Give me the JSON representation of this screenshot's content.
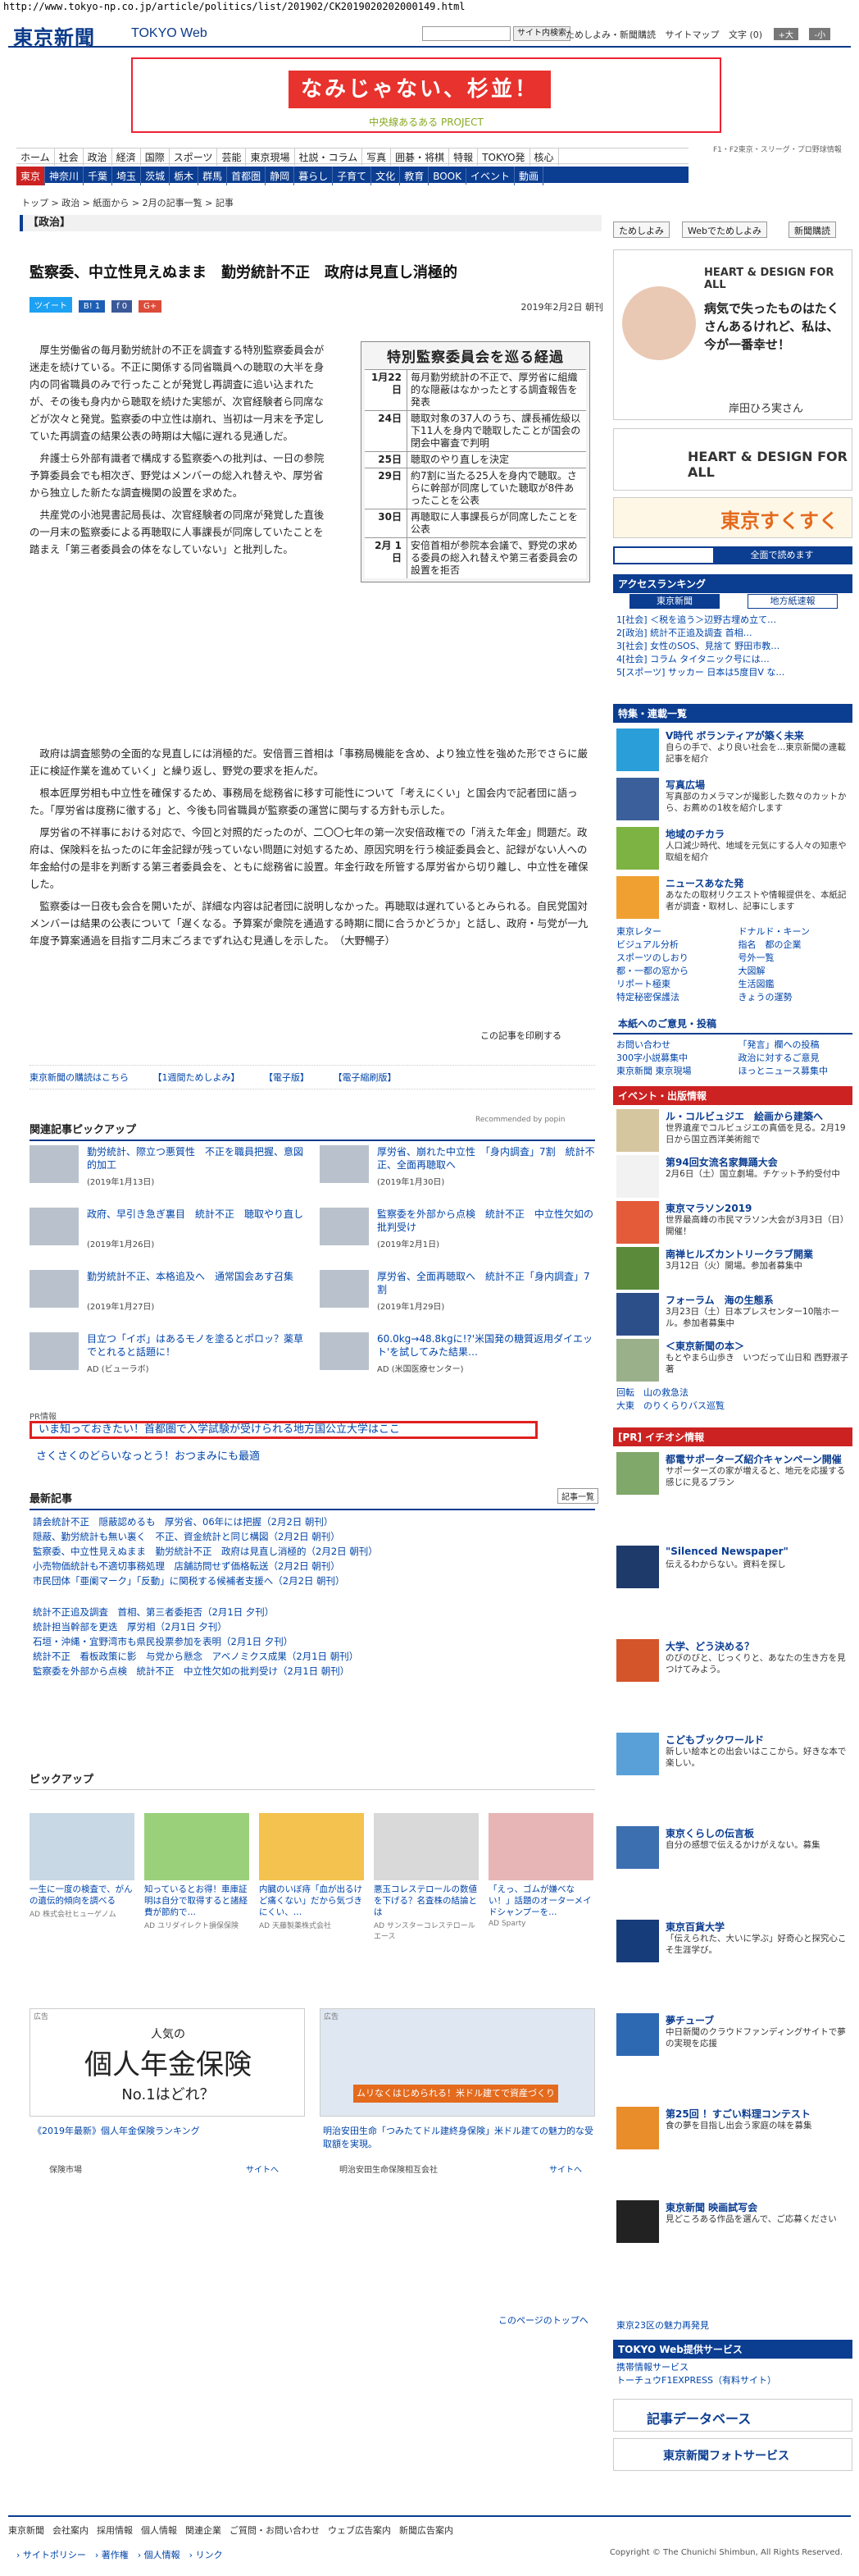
{
  "url": "http://www.tokyo-np.co.jp/article/politics/list/201902/CK2019020202000149.html",
  "header": {
    "logo": "東京新聞",
    "logo_sub": "TOKYO Web",
    "search_button": "サイト内検索",
    "links": [
      "ためしよみ・新聞購読",
      "サイトマップ",
      "文字 (0)"
    ],
    "size_plus": "+大",
    "size_minus": "-小"
  },
  "banner": {
    "main": "なみじゃない、杉並！",
    "sub": "中央線あるある PROJECT"
  },
  "nav_top": [
    "ホーム",
    "社会",
    "政治",
    "経済",
    "国際",
    "スポーツ",
    "芸能",
    "東京現場",
    "社説・コラム",
    "写真",
    "囲碁・将棋",
    "特報",
    "TOKYO発",
    "核心"
  ],
  "nav_bottom": [
    "東京",
    "神奈川",
    "千葉",
    "埼玉",
    "茨城",
    "栃木",
    "群馬",
    "首都圏",
    "静岡",
    "暮らし",
    "子育て",
    "文化",
    "教育",
    "BOOK",
    "イベント",
    "動画"
  ],
  "sponsor_small": "F1・F2東京・スリーグ・プロ野球情報",
  "breadcrumb": "トップ > 政治 > 紙面から > 2月の記事一覧 > 記事",
  "section": "【政治】",
  "article": {
    "headline": "監察委、中立性見えぬまま　勤労統計不正　政府は見直し消極的",
    "share": [
      "ツイート",
      "B! 1",
      "f 0",
      "G+"
    ],
    "date": "2019年2月2日 朝刊",
    "lead": [
      "厚生労働省の毎月勤労統計の不正を調査する特別監察委員会が迷走を続けている。不正に関係する同省職員への聴取の大半を身内の同省職員のみで行ったことが発覚し再調査に追い込まれたが、その後も身内から聴取を続けた実態が、次官経験者ら同席などが次々と発覚。監察委の中立性は崩れ、当初は一月末を予定していた再調査の結果公表の時期は大幅に遅れる見通しだ。",
      "弁護士ら外部有識者で構成する監察委への批判は、一日の参院予算委員会でも相次ぎ、野党はメンバーの総入れ替えや、厚労省から独立した新たな調査機関の設置を求めた。",
      "共産党の小池晃書記局長は、次官経験者の同席が発覚した直後の一月末の監察委による再聴取に人事課長が同席していたことを踏まえ「第三者委員会の体をなしていない」と批判した。"
    ],
    "body": [
      "政府は調査態勢の全面的な見直しには消極的だ。安倍晋三首相は「事務局機能を含め、より独立性を強めた形でさらに厳正に検証作業を進めていく」と繰り返し、野党の要求を拒んだ。",
      "根本匠厚労相も中立性を確保するため、事務局を総務省に移す可能性について「考えにくい」と国会内で記者団に語った。「厚労省は度務に徹する」と、今後も同省職員が監察委の運営に関与する方針も示した。",
      "厚労省の不祥事における対応で、今回と対照的だったのが、二〇〇七年の第一次安倍政権での「消えた年金」問題だ。政府は、保険料を払ったのに年金記録が残っていない問題に対処するため、原因究明を行う検証委員会と、記録がない人への年金給付の是非を判断する第三者委員会を、ともに総務省に設置。年金行政を所管する厚労省から切り離し、中立性を確保した。",
      "監察委は一日夜も会合を開いたが、詳細な内容は記者団に説明しなかった。再聴取は遅れているとみられる。自民党国対メンバーは結果の公表について「遅くなる。予算案が衆院を通過する時期に間に合うかどうか」と話し、政府・与党が一九年度予算案通過を目指す二月末ごろまでずれ込む見通しを示した。　（大野暢子）"
    ],
    "print_link": "この記事を印刷する"
  },
  "timeline": {
    "title": "特別監察委員会を巡る経過",
    "rows": [
      {
        "date": "1月22日",
        "text": "毎月勤労統計の不正で、厚労省に組織的な隠蔽はなかったとする調査報告を発表"
      },
      {
        "date": "24日",
        "text": "聴取対象の37人のうち、課長補佐級以下11人を身内で聴取したことが国会の閉会中審査で判明"
      },
      {
        "date": "25日",
        "text": "聴取のやり直しを決定"
      },
      {
        "date": "29日",
        "text": "約7割に当たる25人を身内で聴取。さらに幹部が同席していた聴取が8件あったことを公表"
      },
      {
        "date": "30日",
        "text": "再聴取に人事課長らが同席したことを公表"
      },
      {
        "date": "2月 1日",
        "text": "安倍首相が参院本会議で、野党の求める委員の総入れ替えや第三者委員会の設置を拒否"
      }
    ]
  },
  "links_row": [
    "東京新聞の購読はこちら",
    "【1週間ためしよみ】",
    "【電子版】",
    "【電子縮刷版】"
  ],
  "related": {
    "heading": "関連記事ピックアップ",
    "recommended": "Recommended by popin",
    "items": [
      {
        "title": "勤労統計、際立つ悪質性　不正を職員把握、意図的加工",
        "date": "(2019年1月13日)"
      },
      {
        "title": "厚労省、崩れた中立性　「身内調査」7割　統計不正、全面再聴取へ",
        "date": "(2019年1月30日)"
      },
      {
        "title": "政府、早引き急ぎ裏目　統計不正　聴取やり直し",
        "date": "(2019年1月26日)"
      },
      {
        "title": "監察委を外部から点検　統計不正　中立性欠如の批判受け",
        "date": "(2019年2月1日)"
      },
      {
        "title": "勤労統計不正、本格追及へ　通常国会あす召集",
        "date": "(2019年1月27日)"
      },
      {
        "title": "厚労省、全面再聴取へ　統計不正「身内調査」7割",
        "date": "(2019年1月29日)"
      },
      {
        "title": "目立つ「イボ」はあるモノを塗るとポロッ？薬草でとれると話題に！",
        "date": "AD (ビューラボ)"
      },
      {
        "title": "60.0kg→48.8kgに!?'米国発の糖質返用ダイエット'を試してみた結果…",
        "date": "AD (米国医療センター)"
      }
    ]
  },
  "pr": {
    "label": "PR情報",
    "line1": "いま知っておきたい！首都圏で入学試験が受けられる地方国公立大学はここ",
    "line2": "さくさくのどらいなっとう！おつまみにも最適"
  },
  "latest": {
    "heading": "最新記事",
    "button": "記事一覧",
    "group1": [
      "請会統計不正　隠蔽認めるも　厚労省、06年には把握（2月2日 朝刊）",
      "隠蔽、勤労統計も無い裏く　不正、資金統計と同じ構図（2月2日 朝刊）",
      "監察委、中立性見えぬまま　勤労統計不正　政府は見直し消極的（2月2日 朝刊）",
      "小売物価統計も不適切事務処理　店舗訪問せず価格転送（2月2日 朝刊）",
      "市民団体「亜阑マーク」「反動」に関税する候補者支援へ（2月2日 朝刊）"
    ],
    "group2": [
      "統計不正追及調査　首相、第三者委拒否（2月1日 夕刊）",
      "統計担当幹部を更迭　厚労相（2月1日 夕刊）",
      "石垣・沖縄・宜野湾市も県民投票参加を表明（2月1日 夕刊）",
      "統計不正　看板政策に影　与党から懸念　アベノミクス成果（2月1日 朝刊）",
      "監察委を外部から点検　統計不正　中立性欠如の批判受け（2月1日 朝刊）"
    ]
  },
  "pickup": {
    "heading": "ピックアップ",
    "items": [
      {
        "text": "一生に一度の検査で、がんの遺伝的傾向を調べる",
        "src": "AD 株式会社ヒューゲノム"
      },
      {
        "text": "知っているとお得！車庫証明は自分で取得すると諸経費が節約で…",
        "src": "AD ユリダイレクト損保保険"
      },
      {
        "text": "内臓のいぼ痔「血が出るけど痛くない」だから気づきにくい、…",
        "src": "AD 天藤製薬株式会社"
      },
      {
        "text": "悪玉コレステロールの数値を下げる？名査株の結論とは",
        "src": "AD サンスターコレステロールエース"
      },
      {
        "text": "「えっ、ゴムが嫌べない！」話題のオーターメイドシャンプーを…",
        "src": "AD Sparty"
      }
    ]
  },
  "ads": {
    "left": {
      "label": "広告",
      "headline": "人気の",
      "main": "個人年金保険",
      "sub": "No.1はどれ？",
      "caption": "《2019年最新》個人年金保険ランキング",
      "source": "保険市場",
      "more": "サイトへ"
    },
    "right": {
      "label": "広告",
      "headline": "ムリなくはじめられる！米ドル建てで資産づくり",
      "caption": "明治安田生命「つみたてドル建終身保険」米ドル建ての魅力的な受取額を実現。",
      "source": "明治安田生命保険相互会社",
      "more": "サイトへ"
    }
  },
  "page_top": "このページのトップへ",
  "sidebar": {
    "buttons": [
      "ためしよみ",
      "Webでためしよみ",
      "新聞購読"
    ],
    "ad_top": {
      "title": "HEART & DESIGN FOR ALL",
      "text": "病気で失ったものはたくさんあるけれど、私は、今が一番幸せ！",
      "person": "岸田ひろ実さん"
    },
    "ad2": "HEART & DESIGN FOR ALL",
    "sukusuku": "東京すくすく",
    "premium": "全面で読めます",
    "ranking": {
      "heading": "アクセスランキング",
      "tabs": [
        "東京新聞",
        "地方紙速報"
      ],
      "items": [
        "1[社会] ＜税を追う＞辺野古埋め立て…",
        "2[政治] 統計不正追及調査 首相…",
        "3[社会] 女性のSOS、見捨て 野田市教…",
        "4[社会] コラム タイタニック号には…",
        "5[スポーツ] サッカー 日本は5度目V な…"
      ]
    },
    "special": {
      "heading": "特集・連載一覧",
      "items": [
        {
          "title": "V時代 ボランティアが築く未来",
          "text": "自らの手で、より良い社会を…東京新聞の連載記事を紹介"
        },
        {
          "title": "写真広場",
          "text": "写真部のカメラマンが撮影した数々のカットから、お薦めの1枚を紹介します"
        },
        {
          "title": "地域のチカラ",
          "text": "人口減少時代、地域を元気にする人々の知恵や取組を紹介"
        },
        {
          "title": "ニュースあなた発",
          "text": "あなたの取材リクエストや情報提供を、本紙記者が調査・取材し、記事にします"
        }
      ]
    },
    "links": [
      "東京レター",
      "ビジュアル分析",
      "スポーツのしおり",
      "都・一都の窓から",
      "リポート極東",
      "特定秘密保護法",
      "ドナルド・キーン",
      "指名　都の企業",
      "号外一覧",
      "大図解",
      "生活図鑑",
      "きょうの運勢"
    ],
    "info_heading": "本紙へのご意見・投稿",
    "info_items": [
      "お問い合わせ",
      "300字小説募集中",
      "東京新聞 東京現場",
      "「発言」欄への投稿",
      "政治に対するご意見",
      "ほっとニュース募集中"
    ],
    "events_heading": "イベント・出版情報",
    "events": [
      {
        "title": "ル・コルビュジエ　絵画から建築へ",
        "text": "世界遺産でコルビュジエの真価を見る。2月19日から国立西洋美術館で"
      },
      {
        "title": "第94回女流名家舞踊大会",
        "text": "2月6日（土）国立劇場。チケット予約受付中"
      },
      {
        "title": "東京マラソン2019",
        "text": "世界最高峰の市民マラソン大会が3月3日（日）開催！"
      },
      {
        "title": "南禅ヒルズカントリークラブ開業",
        "text": "3月12日（火）開場。参加者募集中"
      },
      {
        "title": "フォーラム　海の生態系",
        "text": "3月23日（土）日本プレスセンター10階ホール。参加者募集中"
      },
      {
        "title": "＜東京新聞の本＞",
        "text": "もとやまら山歩き　いつだって山日和 西野淑子 著"
      }
    ],
    "misc": [
      "回転　山の救急法",
      "大東　のりくらりバス巡覧"
    ],
    "ion_heading": "[PR] イチオシ情報",
    "ion": [
      {
        "title": "都電サポーターズ紹介キャンペーン開催",
        "text": "サポーターズの家が増えると、地元を応援する感じに見るプラン"
      },
      {
        "title": "\"Silenced Newspaper\"",
        "text": "伝えるわからない。資料を探し"
      },
      {
        "title": "大学、どう決める？",
        "text": "のびのびと、じっくりと、あなたの生き方を見つけてみよう。"
      },
      {
        "title": "こどもブックワールド",
        "text": "新しい絵本との出会いはここから。好きな本で楽しい。"
      },
      {
        "title": "東京くらしの伝言板",
        "text": "自分の感想で伝えるかけがえない。募集"
      },
      {
        "title": "東京百貨大学",
        "text": "「伝えられた、大いに学ぶ」好奇心と探究心こそ生涯学び。"
      },
      {
        "title": "夢チューブ",
        "text": "中日新聞のクラウドファンディングサイトで夢の実現を応援"
      },
      {
        "title": "第25回 ！すごい料理コンテスト",
        "text": "食の夢を目指し出会う家庭の味を募集"
      },
      {
        "title": "東京新聞 映画試写会",
        "text": "見どころある作品を選んで、ご応募ください"
      }
    ],
    "tokyo_bottom": "東京23区の魅力再発見",
    "tokyoweb_heading": "TOKYO Web提供サービス",
    "tokyoweb_items": [
      "携帯情報サービス",
      "トーチュウF1EXPRESS（有料サイト）"
    ],
    "db": "記事データベース",
    "photo": "東京新聞フォトサービス"
  },
  "footer": {
    "links": [
      "東京新聞",
      "会社案内",
      "採用情報",
      "個人情報",
      "関連企業",
      "ご質問・お問い合わせ",
      "ウェブ広告案内",
      "新聞広告案内"
    ],
    "links2": "› サイトポリシー　› 著作権　› 個人情報　› リンク",
    "copyright": "Copyright © The Chunichi Shimbun, All Rights Reserved."
  }
}
